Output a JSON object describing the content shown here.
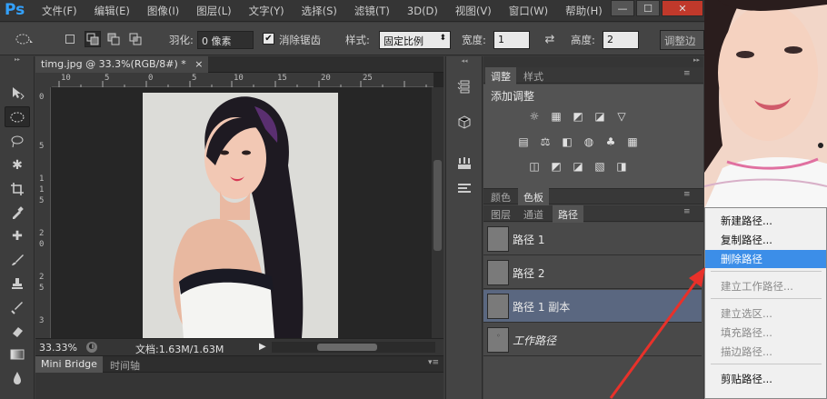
{
  "app": {
    "logo": "Ps"
  },
  "menu": [
    "文件(F)",
    "编辑(E)",
    "图像(I)",
    "图层(L)",
    "文字(Y)",
    "选择(S)",
    "滤镜(T)",
    "3D(D)",
    "视图(V)",
    "窗口(W)",
    "帮助(H)"
  ],
  "window_controls": {
    "minimize": "—",
    "restore": "☐",
    "close": "✕"
  },
  "options": {
    "feather_label": "羽化:",
    "feather_value": "0 像素",
    "antialias_label": "消除锯齿",
    "style_label": "样式:",
    "style_value": "固定比例",
    "width_label": "宽度:",
    "width_value": "1",
    "height_label": "高度:",
    "height_value": "2",
    "refine_button": "调整边"
  },
  "document": {
    "tab_title": "timg.jpg @ 33.3%(RGB/8#) *",
    "tab_close": "×",
    "ruler_h": [
      "10",
      "5",
      "0",
      "5",
      "10",
      "15",
      "20",
      "25"
    ],
    "ruler_v": [
      "0",
      "5",
      "1",
      "1",
      "5",
      "2",
      "0",
      "2",
      "5",
      "3"
    ],
    "zoom": "33.33%",
    "doc_info": "文档:1.63M/1.63M"
  },
  "bottom_tabs": [
    "Mini Bridge",
    "时间轴"
  ],
  "panels": {
    "adjust_tabs": [
      "调整",
      "样式"
    ],
    "adjust_title": "添加调整",
    "adjust_icons_row1": [
      "☼",
      "▦",
      "◩",
      "◪",
      "▽"
    ],
    "adjust_icons_row2": [
      "▤",
      "⚖",
      "◧",
      "◍",
      "♣",
      "▦"
    ],
    "adjust_icons_row3": [
      "◫",
      "◩",
      "◪",
      "▧",
      "◨"
    ],
    "color_tabs": [
      "颜色",
      "色板"
    ],
    "layer_tabs": [
      "图层",
      "通道",
      "路径"
    ],
    "paths": [
      {
        "name": "路径 1"
      },
      {
        "name": "路径 2"
      },
      {
        "name": "路径 1 副本"
      },
      {
        "name": "工作路径"
      }
    ]
  },
  "context_menu": {
    "items": [
      {
        "label": "新建路径...",
        "state": "normal"
      },
      {
        "label": "复制路径...",
        "state": "normal"
      },
      {
        "label": "删除路径",
        "state": "highlight"
      },
      {
        "label": "建立工作路径...",
        "state": "disabled"
      },
      {
        "label": "建立选区...",
        "state": "disabled"
      },
      {
        "label": "填充路径...",
        "state": "disabled"
      },
      {
        "label": "描边路径...",
        "state": "disabled"
      },
      {
        "label": "剪贴路径...",
        "state": "normal"
      }
    ]
  },
  "colors": {
    "accent": "#3c8ee8",
    "arrow": "#e8312a",
    "selected_row": "#5a6780"
  }
}
